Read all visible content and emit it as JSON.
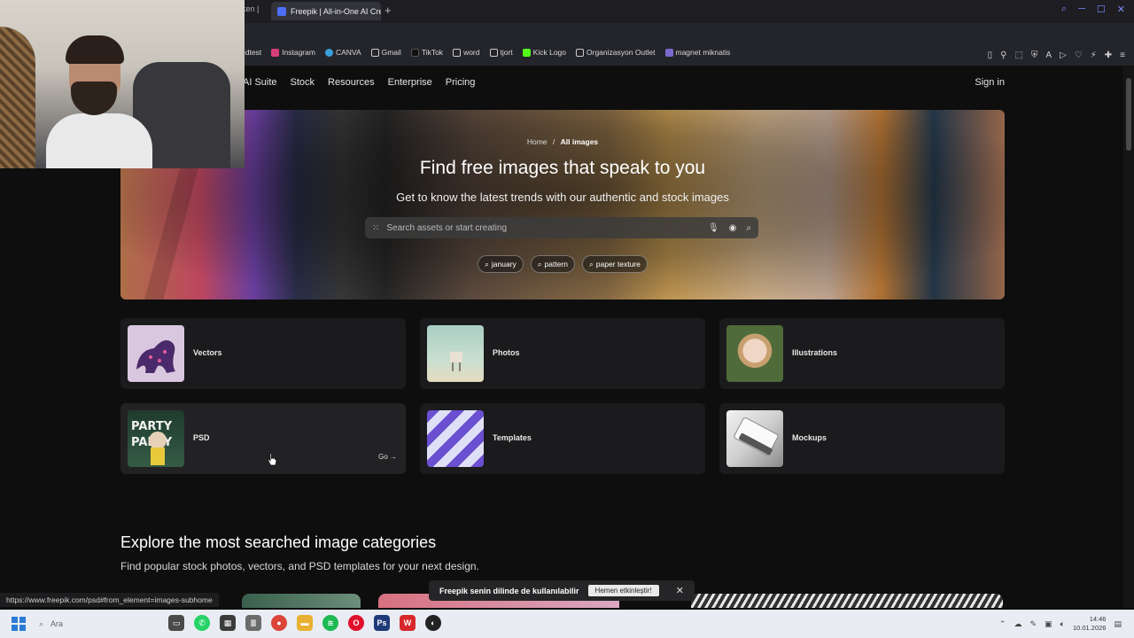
{
  "browser": {
    "prev_tab_label": "rken |",
    "active_tab_label": "Freepik | All-in-One AI Cre",
    "new_tab_symbol": "+",
    "bookmarks": [
      {
        "label": "edtest",
        "color": "#444444"
      },
      {
        "label": "Instagram",
        "color": "#d6407a"
      },
      {
        "label": "CANVA",
        "color": "#3aa0d8"
      },
      {
        "label": "Gmail",
        "color": "#cccccc"
      },
      {
        "label": "TikTok",
        "color": "#111111"
      },
      {
        "label": "word",
        "color": "#cccccc"
      },
      {
        "label": "tjort",
        "color": "#cccccc"
      },
      {
        "label": "Kick Logo",
        "color": "#53fc18"
      },
      {
        "label": "Organizasyon Outlet",
        "color": "#cccccc"
      },
      {
        "label": "magnet miknatis",
        "color": "#7a6ad0"
      }
    ]
  },
  "nav": {
    "items": [
      "AI Suite",
      "Stock",
      "Resources",
      "Enterprise",
      "Pricing"
    ],
    "sign_in": "Sign in"
  },
  "hero": {
    "breadcrumb_home": "Home",
    "breadcrumb_sep": "/",
    "breadcrumb_current": "All images",
    "title": "Find free images that speak to you",
    "subtitle": "Get to know the latest trends with our authentic and stock images",
    "search_placeholder": "Search assets or start creating",
    "chips": [
      "january",
      "pattern",
      "paper texture"
    ]
  },
  "categories": [
    {
      "label": "Vectors"
    },
    {
      "label": "Photos"
    },
    {
      "label": "Illustrations"
    },
    {
      "label": "PSD",
      "go": "Go →"
    },
    {
      "label": "Templates"
    },
    {
      "label": "Mockups"
    }
  ],
  "explore": {
    "title": "Explore the most searched image categories",
    "subtitle": "Find popular stock photos, vectors, and PSD templates for your next design."
  },
  "toast": {
    "text": "Freepik senin dilinde de kullanılabilir",
    "button": "Hemen etkinleştir!",
    "close": "✕"
  },
  "status_url": "https://www.freepik.com/psd#from_element=images-subhome",
  "taskbar": {
    "search_placeholder": "Ara",
    "time": "14:46",
    "date": "10.01.2026",
    "apps": [
      {
        "name": "files-icon",
        "color": "#4a4a4a"
      },
      {
        "name": "whatsapp-icon",
        "color": "#25d366"
      },
      {
        "name": "calculator-icon",
        "color": "#3b3b3b"
      },
      {
        "name": "notepad-icon",
        "color": "#6b6b6b"
      },
      {
        "name": "chrome-icon",
        "color": "#db4437"
      },
      {
        "name": "folder-icon",
        "color": "#e8b030"
      },
      {
        "name": "spotify-icon",
        "color": "#1db954"
      },
      {
        "name": "opera-icon",
        "color": "#e0102b"
      },
      {
        "name": "photoshop-icon",
        "color": "#1e3a7a"
      },
      {
        "name": "wps-icon",
        "color": "#d8272b"
      },
      {
        "name": "github-icon",
        "color": "#222222"
      }
    ]
  }
}
